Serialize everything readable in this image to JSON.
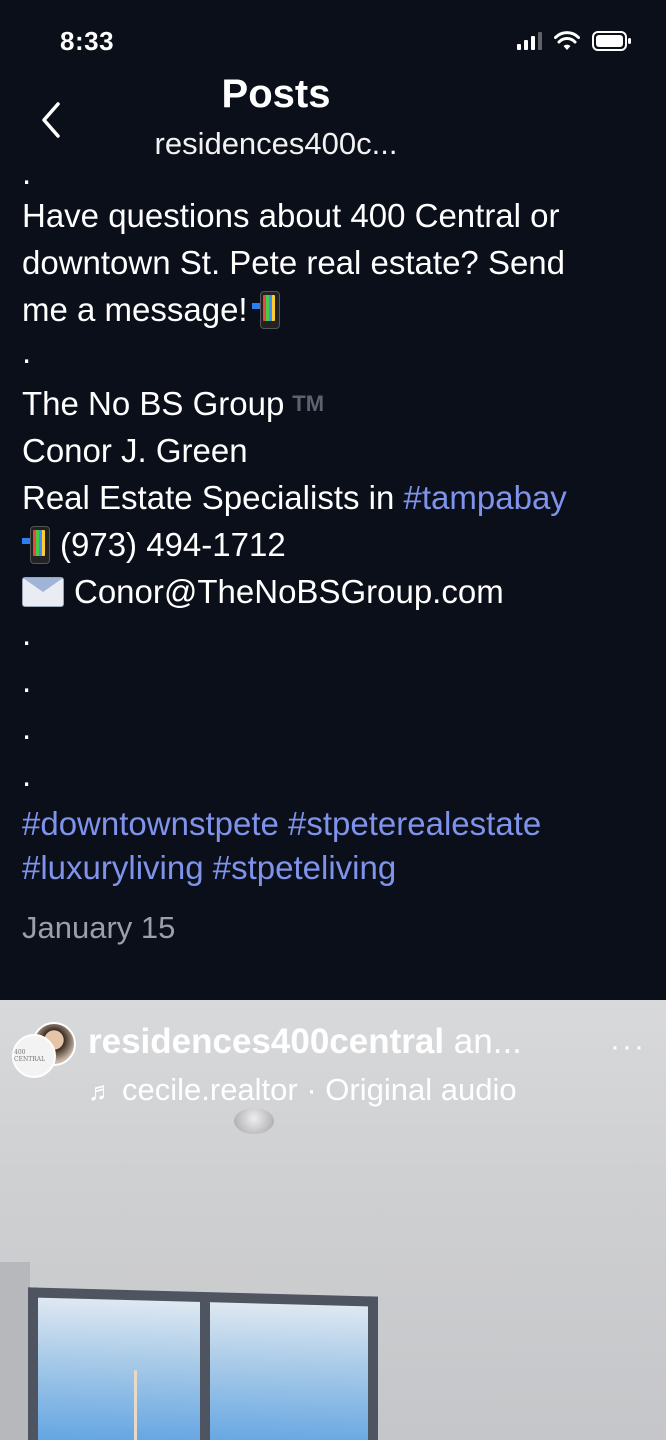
{
  "status_bar": {
    "time": "8:33"
  },
  "nav": {
    "title": "Posts",
    "subtitle": "residences400c..."
  },
  "caption": {
    "top_dot": ".",
    "line1": "Have questions about 400 Central or",
    "line2": "downtown St. Pete real estate? Send",
    "line3": "me a message!",
    "dot2": ".",
    "group": "The No BS Group",
    "tm": "TM",
    "name": "Conor J. Green",
    "specialists": "Real Estate Specialists in ",
    "tag_tampabay": "#tampabay",
    "phone": "(973) 494-1712",
    "email": "Conor@TheNoBSGroup.com",
    "dots": [
      ".",
      ".",
      ".",
      "."
    ],
    "tag_downtownstpete": "#downtownstpete",
    "tag_stpeterealestate": "#stpeterealestate",
    "tag_luxuryliving": "#luxuryliving",
    "tag_stpeteliving": "#stpeteliving"
  },
  "date": "January 15",
  "reel": {
    "username": "residences400central",
    "username_suffix": " an...",
    "audio_note": "♬",
    "audio": "cecile.realtor · Original audio",
    "more": "···",
    "avatar_text": "400 CENTRAL"
  },
  "colors": {
    "background": "#0b0f19",
    "hashtag": "#7f93ec",
    "date": "#9aa0ab"
  }
}
